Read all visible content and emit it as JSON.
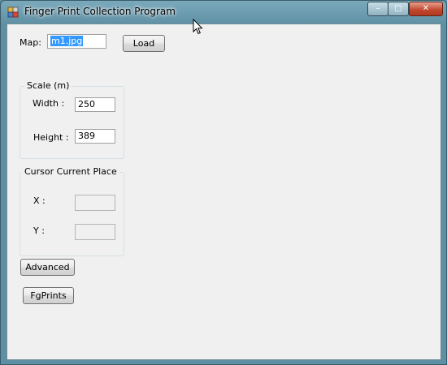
{
  "window": {
    "title": "Finger Print Collection Program",
    "controls": {
      "minimize": "–",
      "maximize": "□",
      "close": "✕"
    }
  },
  "map": {
    "label": "Map:",
    "value": "m1.jpg",
    "load_button": "Load"
  },
  "scale": {
    "group_title": "Scale (m)",
    "width_label": "Width :",
    "width_value": "250",
    "height_label": "Height :",
    "height_value": "389"
  },
  "cursor_place": {
    "group_title": "Cursor Current Place",
    "x_label": "X :",
    "x_value": "",
    "y_label": "Y :",
    "y_value": ""
  },
  "buttons": {
    "advanced": "Advanced",
    "fgprints": "FgPrints"
  },
  "icons": {
    "app": "app-icon",
    "pointer": "mouse-pointer-icon"
  },
  "colors": {
    "client_bg": "#f0f0f0",
    "title_bar": "#5f8fa3",
    "selection": "#3399ff",
    "close_button": "#c0462c"
  }
}
